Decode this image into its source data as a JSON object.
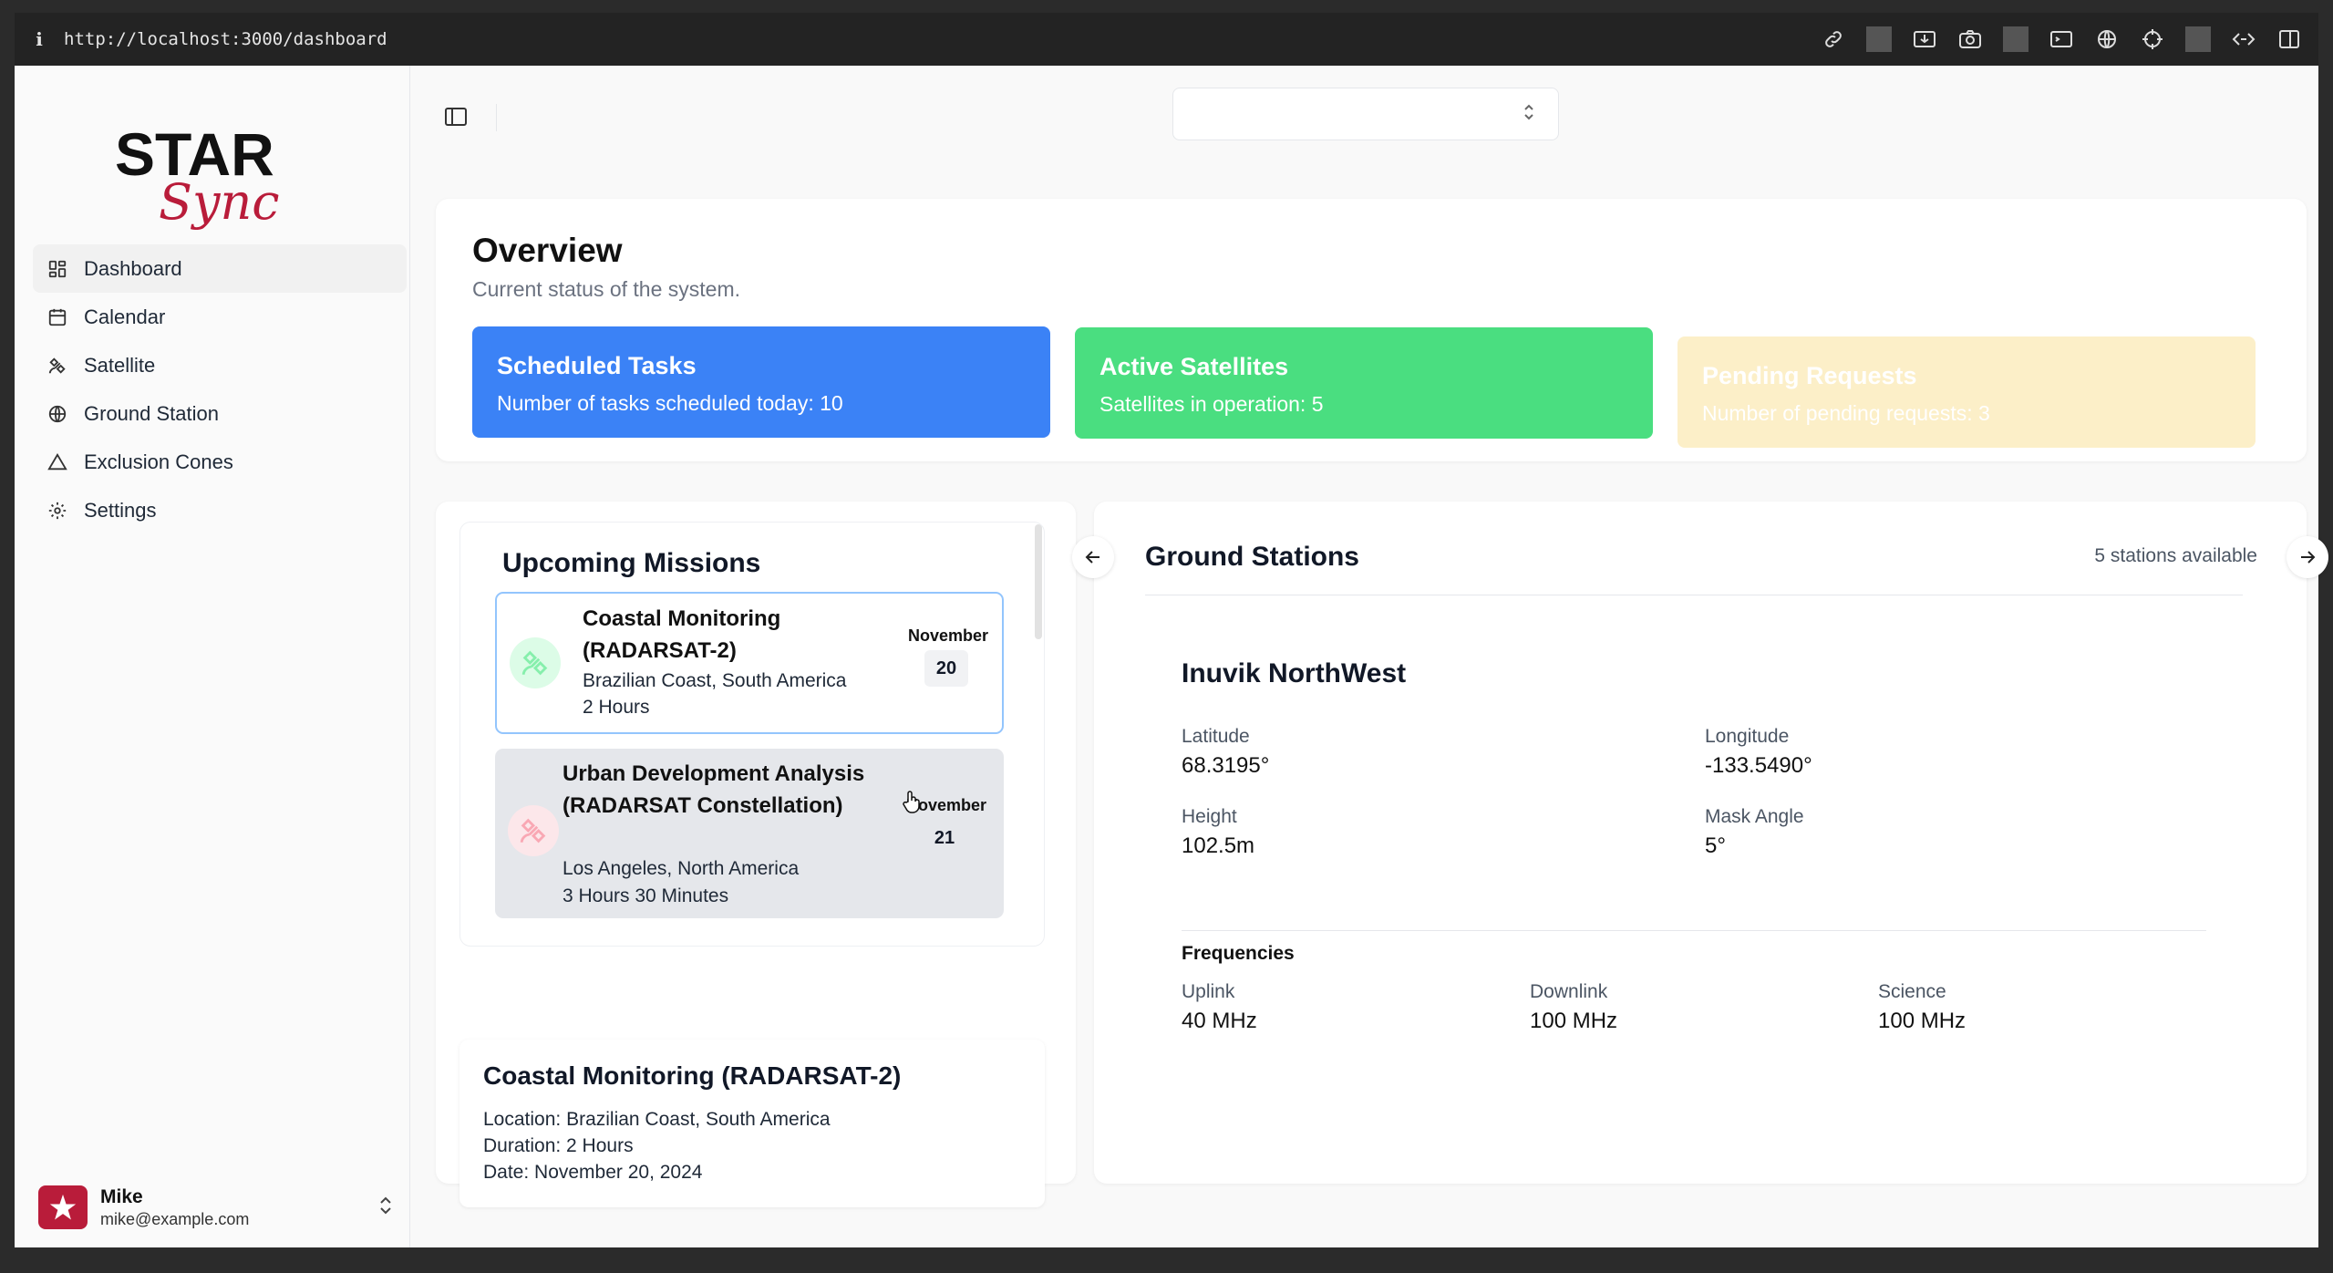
{
  "browser": {
    "url": "http://localhost:3000/dashboard"
  },
  "brand": {
    "logo_top": "STAR",
    "logo_script": "Sync",
    "logo_colors": {
      "top": "#111111",
      "script": "#b91c3a"
    }
  },
  "sidebar": {
    "items": [
      {
        "label": "Dashboard",
        "icon": "dashboard-icon",
        "active": true
      },
      {
        "label": "Calendar",
        "icon": "calendar-icon"
      },
      {
        "label": "Satellite",
        "icon": "satellite-icon"
      },
      {
        "label": "Ground Station",
        "icon": "globe-icon"
      },
      {
        "label": "Exclusion Cones",
        "icon": "cone-icon"
      },
      {
        "label": "Settings",
        "icon": "gear-icon"
      }
    ],
    "user": {
      "name": "Mike",
      "email": "mike@example.com"
    }
  },
  "overview": {
    "title": "Overview",
    "subtitle": "Current status of the system.",
    "stats": [
      {
        "title": "Scheduled Tasks",
        "desc": "Number of tasks scheduled today: 10",
        "color": "#3b82f6"
      },
      {
        "title": "Active Satellites",
        "desc": "Satellites in operation: 5",
        "color": "#4ade80"
      },
      {
        "title": "Pending Requests",
        "desc": "Number of pending requests: 3",
        "color": "#fcefc8"
      }
    ]
  },
  "missions": {
    "title": "Upcoming Missions",
    "items": [
      {
        "name": "Coastal Monitoring (RADARSAT-2)",
        "location": "Brazilian Coast, South America",
        "duration": "2 Hours",
        "month": "November",
        "day": "20"
      },
      {
        "name": "Urban Development Analysis (RADARSAT Constellation)",
        "location": "Los Angeles, North America",
        "duration": "3 Hours 30 Minutes",
        "month": "November",
        "day": "21"
      }
    ],
    "detail": {
      "title": "Coastal Monitoring (RADARSAT-2)",
      "location": "Location: Brazilian Coast, South America",
      "duration": "Duration: 2 Hours",
      "date": "Date: November 20, 2024"
    }
  },
  "ground_stations": {
    "title": "Ground Stations",
    "available": "5 stations available",
    "station": {
      "name": "Inuvik NorthWest",
      "latitude_label": "Latitude",
      "latitude": "68.3195°",
      "longitude_label": "Longitude",
      "longitude": "-133.5490°",
      "height_label": "Height",
      "height": "102.5m",
      "mask_label": "Mask Angle",
      "mask": "5°",
      "freq_title": "Frequencies",
      "uplink_label": "Uplink",
      "uplink": "40 MHz",
      "downlink_label": "Downlink",
      "downlink": "100 MHz",
      "science_label": "Science",
      "science": "100 MHz"
    }
  }
}
